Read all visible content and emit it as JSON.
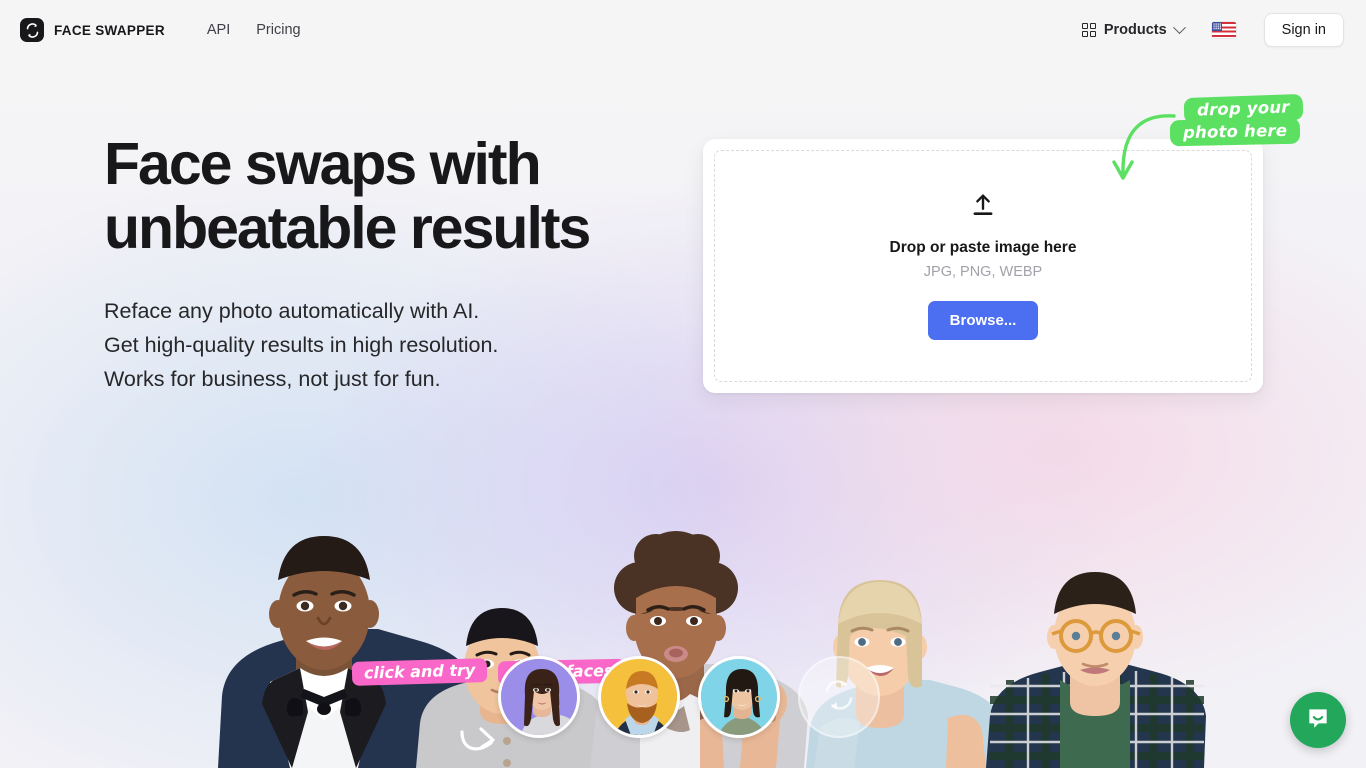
{
  "header": {
    "logo_icon": "face-swap-logo-icon",
    "brand": "FACE SWAPPER",
    "nav": [
      {
        "label": "API"
      },
      {
        "label": "Pricing"
      }
    ],
    "products": {
      "label": "Products",
      "grid_icon": "grid-icon",
      "chevron_icon": "chevron-down-icon"
    },
    "language_flag": "us-flag-icon",
    "signin": "Sign in"
  },
  "hero": {
    "title": "Face swaps with\nunbeatable results",
    "subtitle": "Reface any photo automatically with AI.\nGet high-quality results in high resolution.\nWorks for business, not just for fun."
  },
  "upload": {
    "icon": "upload-arrow-icon",
    "title": "Drop or paste image here",
    "formats": "JPG, PNG, WEBP",
    "browse_label": "Browse..."
  },
  "stickers": {
    "green": {
      "line1": "drop your",
      "line2": "photo here",
      "color": "#5ce061",
      "arrow_icon": "curved-arrow-down-icon"
    },
    "pink": {
      "line1": "click and try",
      "line2": "these faces",
      "color": "#f968c8",
      "arrow_icon": "curved-arrow-up-right-icon"
    }
  },
  "faces": [
    {
      "name": "face-option-1",
      "bg": "#9b8ee8"
    },
    {
      "name": "face-option-2",
      "bg": "#f5c13d"
    },
    {
      "name": "face-option-3",
      "bg": "#7fd4e8"
    }
  ],
  "faces_more_icon": "refresh-swap-icon",
  "chat": {
    "icon": "chat-bubble-icon",
    "color": "#22a75b"
  },
  "colors": {
    "accent_blue": "#4c6ef0",
    "page_bg": "#f4f4f5",
    "text": "#18181b"
  }
}
